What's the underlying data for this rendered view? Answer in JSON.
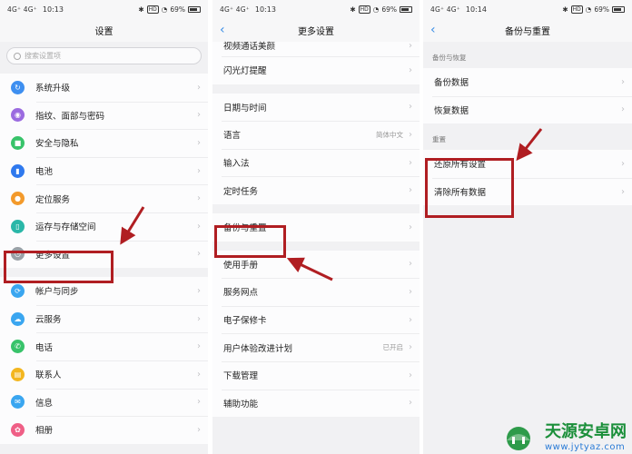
{
  "status": {
    "left": {
      "signal": "4G⁺ 4G⁺ ",
      "time": "10:13"
    },
    "middle": {
      "signal": "4G⁺ 4G⁺ ",
      "time": "10:13"
    },
    "right": {
      "signal": "4G⁺ 4G⁺ ",
      "time": "10:14"
    },
    "hd": "HD",
    "battery": "69%"
  },
  "screen1": {
    "title": "设置",
    "search_placeholder": "搜索设置项",
    "group1": [
      "系统升级",
      "指纹、面部与密码",
      "安全与隐私",
      "电池",
      "定位服务",
      "运存与存储空间",
      "更多设置"
    ],
    "group2": [
      "帐户与同步",
      "云服务",
      "电话",
      "联系人",
      "信息",
      "相册"
    ]
  },
  "screen2": {
    "title": "更多设置",
    "group1": [
      "视频通话美颜",
      "闪光灯提醒"
    ],
    "group2": [
      "日期与时间",
      "语言",
      "输入法",
      "定时任务"
    ],
    "language_value": "简体中文",
    "group3": [
      "备份与重置"
    ],
    "group4": [
      "使用手册",
      "服务网点",
      "电子保修卡",
      "用户体验改进计划",
      "下载管理",
      "辅助功能"
    ],
    "ux_value": "已开启"
  },
  "screen3": {
    "title": "备份与重置",
    "section1": "备份与恢复",
    "items1": [
      "备份数据",
      "恢复数据"
    ],
    "section2": "重置",
    "items2": [
      "还原所有设置",
      "清除所有数据"
    ]
  },
  "watermark": {
    "title": "天源安卓网",
    "url": "www.jytyaz.com"
  },
  "accent_colors": {
    "highlight": "#b01e22",
    "back": "#3a8ee6",
    "watermark_green": "#1b8f3a"
  }
}
